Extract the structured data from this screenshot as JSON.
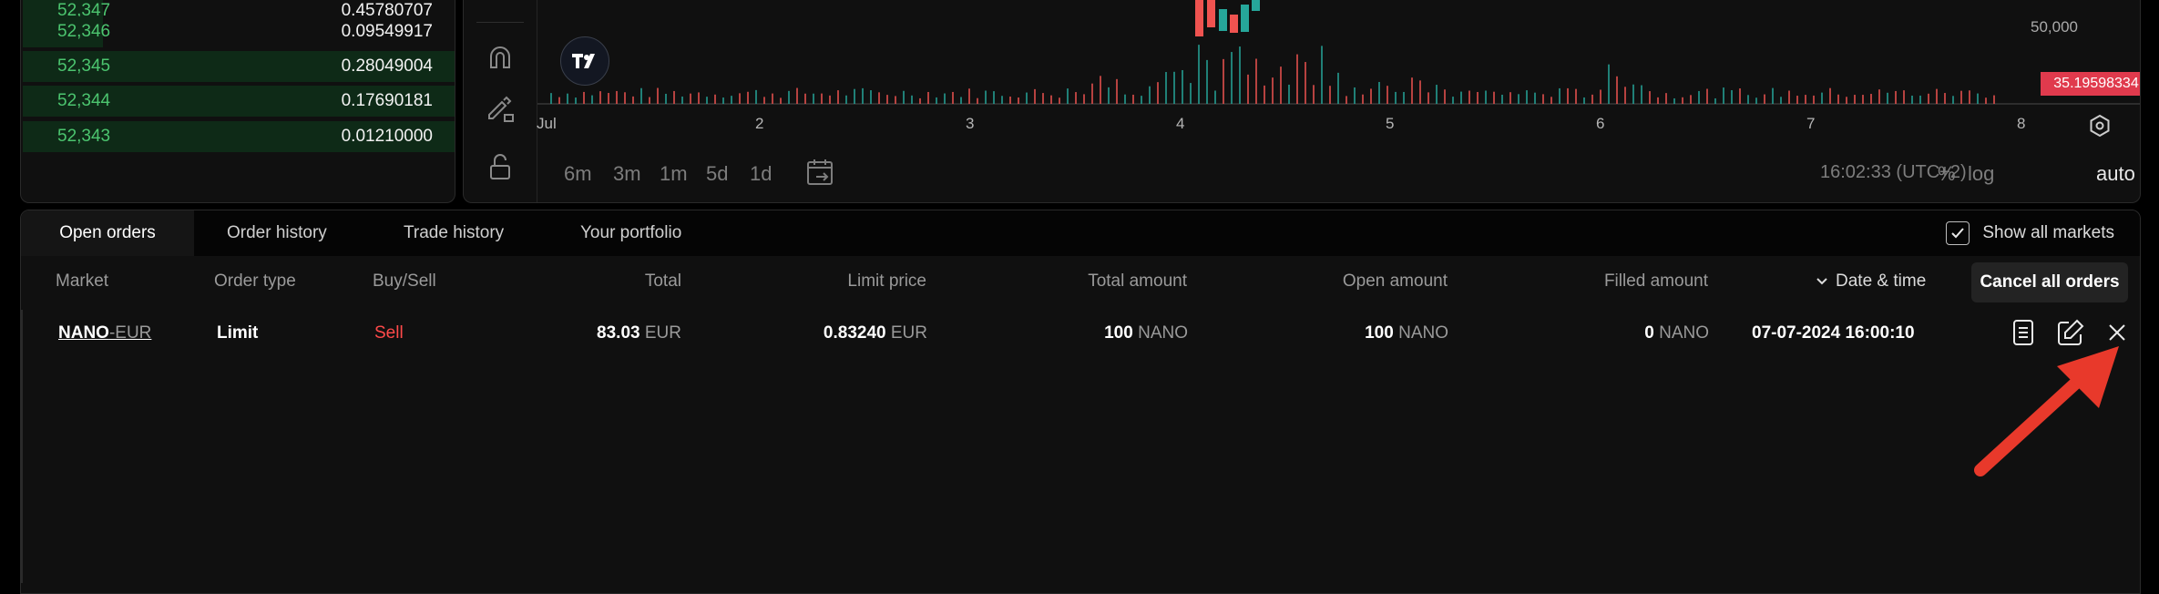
{
  "orderbook": {
    "rows": [
      {
        "price": "52,347",
        "amount": "0.45780707",
        "depth": 0.14
      },
      {
        "price": "52,346",
        "amount": "0.09549917",
        "depth": 0.14
      },
      {
        "price": "52,345",
        "amount": "0.28049004",
        "depth": 1.0
      },
      {
        "price": "52,344",
        "amount": "0.17690181",
        "depth": 1.0
      },
      {
        "price": "52,343",
        "amount": "0.01210000",
        "depth": 1.0
      }
    ]
  },
  "chart": {
    "x_labels": [
      "Jul",
      "2",
      "3",
      "4",
      "5",
      "6",
      "7",
      "8"
    ],
    "y_label": "50,000",
    "price_tag": "35.19598334",
    "timeframes": [
      "6m",
      "3m",
      "1m",
      "5d",
      "1d"
    ],
    "clock": "16:02:33 (UTC+2)",
    "scale_opts": [
      "%",
      "log",
      "auto"
    ],
    "colors": {
      "up": "#26a69a",
      "down": "#ef5350"
    }
  },
  "tabs": [
    "Open orders",
    "Order history",
    "Trade history",
    "Your portfolio"
  ],
  "show_all_markets": "Show all markets",
  "columns": [
    "Market",
    "Order type",
    "Buy/Sell",
    "Total",
    "Limit price",
    "Total amount",
    "Open amount",
    "Filled amount",
    "Date & time"
  ],
  "cancel_all": "Cancel all orders",
  "order": {
    "market_base": "NANO",
    "market_quote": "-EUR",
    "type": "Limit",
    "side": "Sell",
    "total": "83.03",
    "total_unit": "EUR",
    "limit_price": "0.83240",
    "limit_unit": "EUR",
    "total_amount": "100",
    "total_amount_unit": "NANO",
    "open_amount": "100",
    "open_amount_unit": "NANO",
    "filled_amount": "0",
    "filled_amount_unit": "NANO",
    "datetime": "07-07-2024 16:00:10"
  },
  "icons": [
    "details-icon",
    "edit-icon",
    "close-icon",
    "arrow-annotation"
  ]
}
